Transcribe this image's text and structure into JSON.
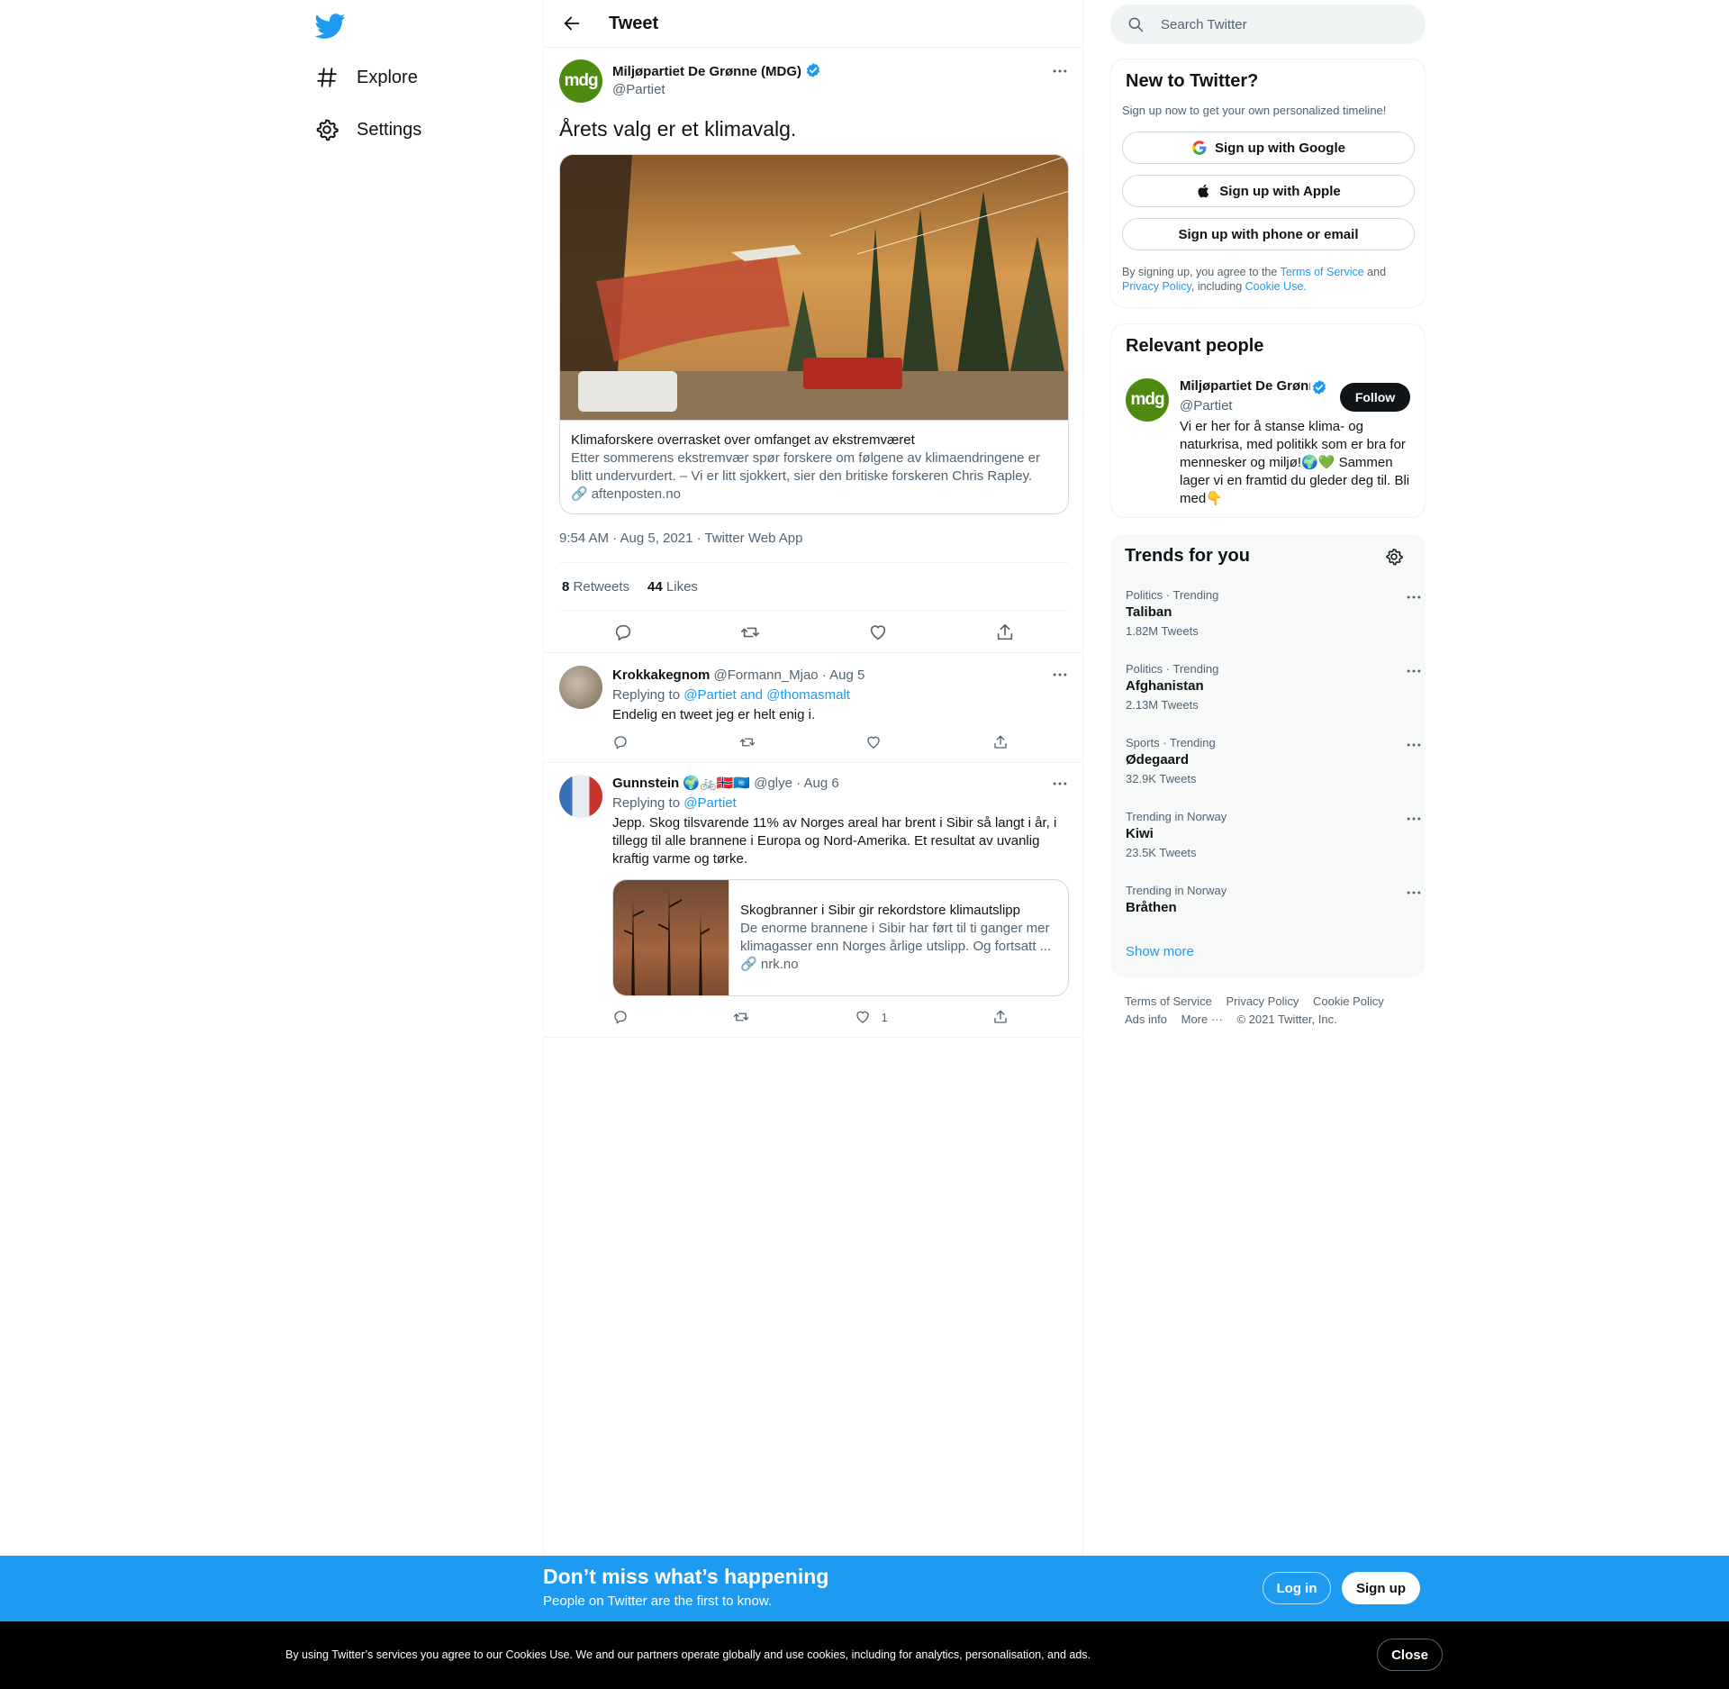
{
  "nav": {
    "explore_label": "Explore",
    "settings_label": "Settings"
  },
  "header": {
    "title": "Tweet"
  },
  "tweet": {
    "author_name": "Miljøpartiet De Grønne (MDG)",
    "author_handle": "@Partiet",
    "avatar_text": "mdg",
    "text": "Årets valg er et klimavalg.",
    "card": {
      "title": "Klimaforskere overrasket over omfanget av ekstremværet",
      "description": "Etter sommerens ekstremvær spør forskere om følgene av klimaendringene er blitt undervurdert. – Vi er litt sjokkert, sier den britiske forskeren Chris Rapley.",
      "domain": "aftenposten.no"
    },
    "timestamp": "9:54 AM · Aug 5, 2021 · Twitter Web App",
    "retweets_count": "8",
    "retweets_label": "Retweets",
    "likes_count": "44",
    "likes_label": "Likes"
  },
  "replies": [
    {
      "name": "Krokkakegnom",
      "handle": "@Formann_Mjao",
      "date": "· Aug 5",
      "replying_prefix": "Replying to",
      "replying_to": "@Partiet and @thomasmalt",
      "text": "Endelig en tweet jeg er helt enig i.",
      "likes": ""
    },
    {
      "name": "Gunnstein",
      "handle": "@glye",
      "date": "· Aug 6",
      "replying_prefix": "Replying to",
      "replying_to": "@Partiet",
      "text": "Jepp. Skog tilsvarende 11% av Norges areal har brent i Sibir så langt i år, i tillegg til alle brannene i Europa og Nord-Amerika. Et resultat av uvanlig kraftig varme og tørke.",
      "card": {
        "title": "Skogbranner i Sibir gir rekordstore klimautslipp",
        "description": "De enorme brannene i Sibir har ført til ti ganger mer klimagasser enn Norges årlige utslipp. Og fortsatt ...",
        "domain": "nrk.no"
      },
      "likes": "1"
    }
  ],
  "search": {
    "placeholder": "Search Twitter"
  },
  "signup_box": {
    "title": "New to Twitter?",
    "subtitle": "Sign up now to get your own personalized timeline!",
    "google": "Sign up with Google",
    "apple": "Sign up with Apple",
    "phone": "Sign up with phone or email",
    "legal_1": "By signing up, you agree to the",
    "terms": "Terms of Service",
    "and": "and",
    "privacy": "Privacy Policy",
    "including": ", including",
    "cookie": "Cookie Use."
  },
  "relevant": {
    "title": "Relevant people",
    "name": "Miljøpartiet De Grønne (MDG)",
    "handle": "@Partiet",
    "follow": "Follow",
    "bio": "Vi er her for å stanse klima- og naturkrisa, med politikk som er bra for mennesker og miljø!🌍💚 Sammen lager vi en framtid du gleder deg til. Bli med👇"
  },
  "trends": {
    "title": "Trends for you",
    "items": [
      {
        "context": "Politics · Trending",
        "name": "Taliban",
        "count": "1.82M Tweets"
      },
      {
        "context": "Politics · Trending",
        "name": "Afghanistan",
        "count": "2.13M Tweets"
      },
      {
        "context": "Sports · Trending",
        "name": "Ødegaard",
        "count": "32.9K Tweets"
      },
      {
        "context": "Trending in Norway",
        "name": "Kiwi",
        "count": "23.5K Tweets"
      },
      {
        "context": "Trending in Norway",
        "name": "Bråthen",
        "count": ""
      }
    ],
    "show_more": "Show more"
  },
  "footer": {
    "terms": "Terms of Service",
    "privacy": "Privacy Policy",
    "cookie": "Cookie Policy",
    "ads": "Ads info",
    "more": "More ···",
    "copyright": "© 2021 Twitter, Inc."
  },
  "bottom_bar": {
    "title": "Don’t miss what’s happening",
    "subtitle": "People on Twitter are the first to know.",
    "login": "Log in",
    "signup": "Sign up"
  },
  "cookie_bar": {
    "text": "By using Twitter’s services you agree to our Cookies Use. We and our partners operate globally and use cookies, including for analytics, personalisation, and ads.",
    "close": "Close"
  },
  "colors": {
    "accent": "#1d9bf0",
    "mdg_green": "#4f8a10",
    "text": "#0f1419",
    "muted": "#536471"
  }
}
